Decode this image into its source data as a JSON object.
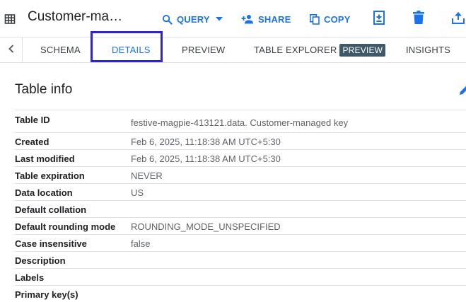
{
  "header": {
    "title": "Customer-ma…",
    "table_icon": "table-grid-icon",
    "actions": {
      "query": "QUERY",
      "share": "SHARE",
      "copy": "COPY"
    },
    "icons": {
      "query": "search-icon",
      "query_dropdown": "caret-down-icon",
      "share": "person-add-icon",
      "copy": "copy-icon",
      "snapshot": "add-document-icon",
      "delete": "trash-icon",
      "export": "upload-icon"
    },
    "accent_color": "#1a73e8"
  },
  "tabs": {
    "scroll_icon": "chevron-left-icon",
    "schema": "SCHEMA",
    "details": "DETAILS",
    "preview": "PREVIEW",
    "table_explorer": "TABLE EXPLORER",
    "table_explorer_badge": "PREVIEW",
    "insights": "INSIGHTS",
    "active": "DETAILS",
    "highlight_color": "#2c24d4"
  },
  "table_info": {
    "title": "Table info",
    "edit_icon": "pencil-icon",
    "rows": [
      {
        "label": "Table ID",
        "value": "festive-magpie-413121.data. Customer-managed key"
      },
      {
        "label": "Created",
        "value": "Feb 6, 2025, 11:18:38 AM UTC+5:30"
      },
      {
        "label": "Last modified",
        "value": "Feb 6, 2025, 11:18:38 AM UTC+5:30"
      },
      {
        "label": "Table expiration",
        "value": "NEVER"
      },
      {
        "label": "Data location",
        "value": "US"
      },
      {
        "label": "Default collation",
        "value": ""
      },
      {
        "label": "Default rounding mode",
        "value": "ROUNDING_MODE_UNSPECIFIED"
      },
      {
        "label": "Case insensitive",
        "value": "false"
      },
      {
        "label": "Description",
        "value": ""
      },
      {
        "label": "Labels",
        "value": ""
      },
      {
        "label": "Primary key(s)",
        "value": ""
      }
    ]
  }
}
